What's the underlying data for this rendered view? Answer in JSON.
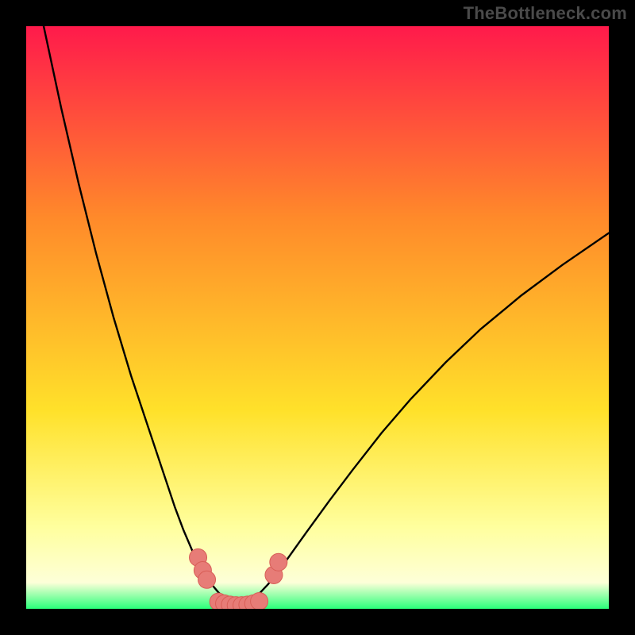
{
  "watermark": "TheBottleneck.com",
  "colors": {
    "frame": "#000000",
    "gradient_top": "#ff1a4b",
    "gradient_mid_upper": "#ff8a2a",
    "gradient_mid": "#ffe12a",
    "gradient_pale_band_top": "#ffff9e",
    "gradient_pale_band_bottom": "#fdffd8",
    "gradient_bottom": "#2aff7a",
    "curve": "#000000",
    "marker_fill": "#e77c77",
    "marker_stroke": "#d85e57"
  },
  "chart_data": {
    "type": "line",
    "title": "",
    "xlabel": "",
    "ylabel": "",
    "xlim": [
      0,
      100
    ],
    "ylim": [
      0,
      100
    ],
    "grid": false,
    "series": [
      {
        "name": "left-curve",
        "x": [
          3,
          6,
          9,
          12,
          15,
          18,
          21,
          24,
          25.5,
          27,
          28.5,
          30,
          31,
          32,
          33,
          34,
          35,
          36,
          37
        ],
        "y": [
          100,
          86,
          73,
          61,
          50,
          40,
          31,
          22,
          17.5,
          13.5,
          10,
          7,
          5.4,
          4.0,
          2.8,
          1.9,
          1.2,
          0.7,
          0.4
        ]
      },
      {
        "name": "right-curve",
        "x": [
          37,
          38,
          39,
          40,
          41.5,
          43,
          45,
          48,
          52,
          56,
          61,
          66,
          72,
          78,
          85,
          92,
          100
        ],
        "y": [
          0.4,
          0.9,
          1.6,
          2.6,
          4.2,
          6.0,
          8.8,
          13.0,
          18.5,
          23.8,
          30.2,
          36.0,
          42.3,
          48.0,
          53.8,
          59.0,
          64.5
        ]
      }
    ],
    "markers": [
      {
        "x": 29.5,
        "y": 8.8
      },
      {
        "x": 30.3,
        "y": 6.6
      },
      {
        "x": 31.0,
        "y": 5.0
      },
      {
        "x": 33.0,
        "y": 1.2
      },
      {
        "x": 34.0,
        "y": 0.9
      },
      {
        "x": 35.0,
        "y": 0.7
      },
      {
        "x": 36.0,
        "y": 0.6
      },
      {
        "x": 37.0,
        "y": 0.6
      },
      {
        "x": 38.0,
        "y": 0.7
      },
      {
        "x": 39.0,
        "y": 0.9
      },
      {
        "x": 40.0,
        "y": 1.3
      },
      {
        "x": 42.5,
        "y": 5.8
      },
      {
        "x": 43.3,
        "y": 8.0
      }
    ],
    "marker_radius": 1.5,
    "note": "Axis tick labels are not shown in the image; x and y are normalized 0–100 across the plot area. Values are read from pixel positions."
  }
}
